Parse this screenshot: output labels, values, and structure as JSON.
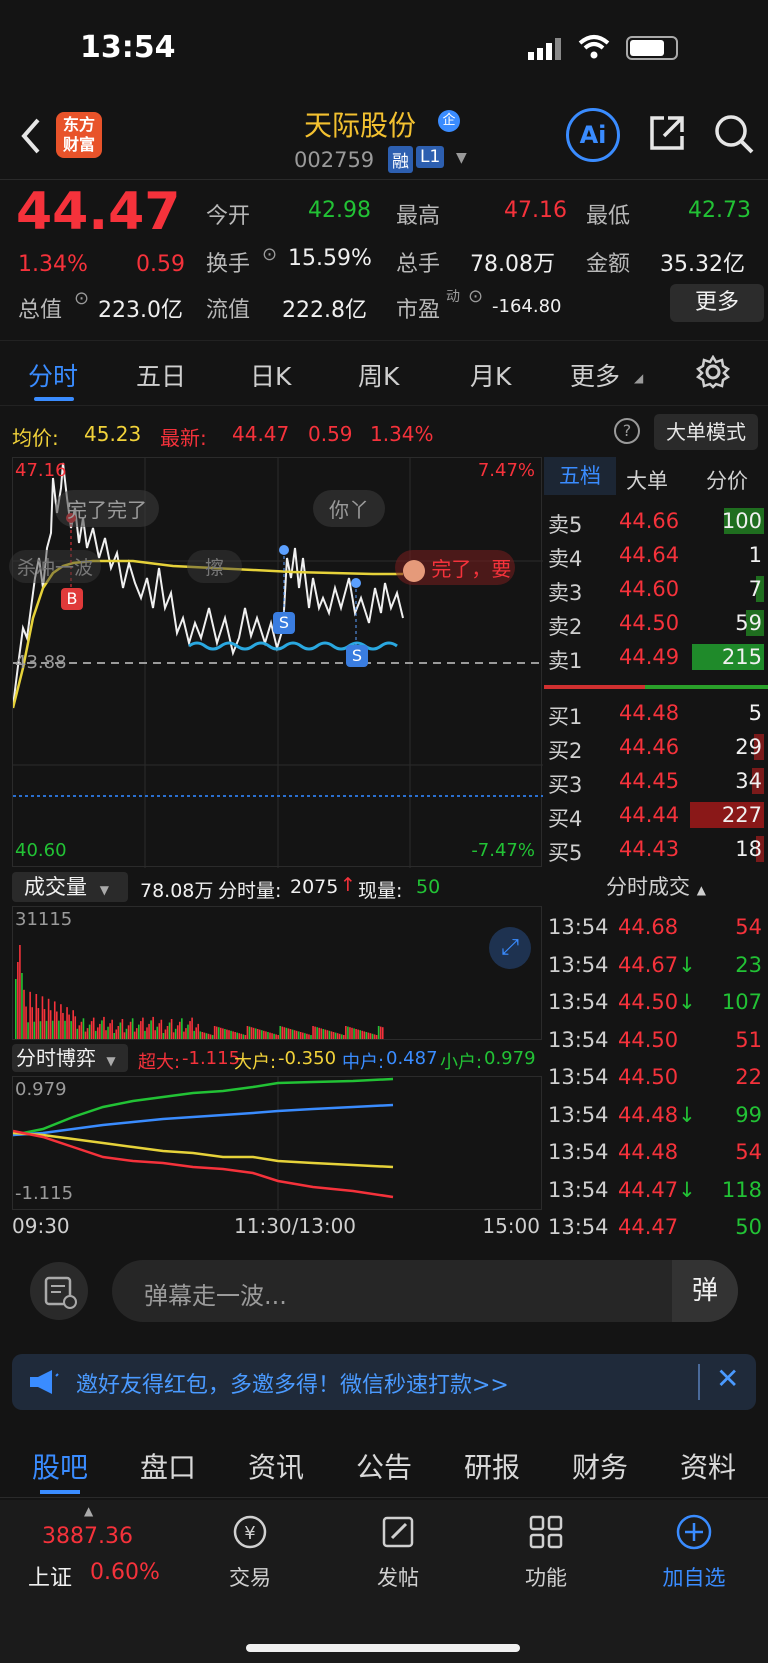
{
  "status": {
    "time": "13:54"
  },
  "header": {
    "stock_name": "天际股份",
    "name_badge": "企",
    "code": "002759",
    "tag_rong": "融",
    "tag_level": "L1",
    "logo_line1": "东方",
    "logo_line2": "财富",
    "ai_label": "Ai"
  },
  "quote": {
    "price": "44.47",
    "pct": "1.34%",
    "chg": "0.59",
    "open_label": "今开",
    "open": "42.98",
    "high_label": "最高",
    "high": "47.16",
    "low_label": "最低",
    "low": "42.73",
    "turnover_label": "换手",
    "turnover": "15.59%",
    "volume_label": "总手",
    "volume": "78.08万",
    "amount_label": "金额",
    "amount": "35.32亿",
    "mktcap_label": "总值",
    "mktcap": "223.0亿",
    "float_label": "流值",
    "float": "222.8亿",
    "pe_label": "市盈",
    "pe_sup": "动",
    "pe": "-164.80",
    "more_btn": "更多"
  },
  "tabs": [
    "分时",
    "五日",
    "日K",
    "周K",
    "月K",
    "更多"
  ],
  "chart_info": {
    "avg_label": "均价:",
    "avg": "45.23",
    "last_label": "最新:",
    "last": "44.47",
    "chg": "0.59",
    "pct": "1.34%",
    "big_order_btn": "大单模式"
  },
  "chart_labels": {
    "top_price": "47.16",
    "top_pct": "7.47%",
    "ref_price": "43.88",
    "bottom_price": "40.60",
    "bottom_pct": "-7.47%"
  },
  "bullets": {
    "b1": "完了完了",
    "b2": "你丫",
    "b3": "杀冲一波",
    "b4": "擦",
    "b5": "完了，要"
  },
  "markers": {
    "buy": "B",
    "sell": "S"
  },
  "depth_tabs": [
    "五档",
    "大单",
    "分价"
  ],
  "asks": [
    {
      "label": "卖5",
      "price": "44.66",
      "vol": "100"
    },
    {
      "label": "卖4",
      "price": "44.64",
      "vol": "1"
    },
    {
      "label": "卖3",
      "price": "44.60",
      "vol": "7"
    },
    {
      "label": "卖2",
      "price": "44.50",
      "vol": "59"
    },
    {
      "label": "卖1",
      "price": "44.49",
      "vol": "215"
    }
  ],
  "bids": [
    {
      "label": "买1",
      "price": "44.48",
      "vol": "5"
    },
    {
      "label": "买2",
      "price": "44.46",
      "vol": "29"
    },
    {
      "label": "买3",
      "price": "44.45",
      "vol": "34"
    },
    {
      "label": "买4",
      "price": "44.44",
      "vol": "227"
    },
    {
      "label": "买5",
      "price": "44.43",
      "vol": "18"
    }
  ],
  "ticks_title": "分时成交",
  "ticks": [
    {
      "t": "13:54",
      "p": "44.68",
      "v": "54",
      "dir": "",
      "vc": "red"
    },
    {
      "t": "13:54",
      "p": "44.67",
      "v": "23",
      "dir": "↓",
      "vc": "green"
    },
    {
      "t": "13:54",
      "p": "44.50",
      "v": "107",
      "dir": "↓",
      "vc": "green"
    },
    {
      "t": "13:54",
      "p": "44.50",
      "v": "51",
      "dir": "",
      "vc": "red"
    },
    {
      "t": "13:54",
      "p": "44.50",
      "v": "22",
      "dir": "",
      "vc": "red"
    },
    {
      "t": "13:54",
      "p": "44.48",
      "v": "99",
      "dir": "↓",
      "vc": "green"
    },
    {
      "t": "13:54",
      "p": "44.48",
      "v": "54",
      "dir": "",
      "vc": "red"
    },
    {
      "t": "13:54",
      "p": "44.47",
      "v": "118",
      "dir": "↓",
      "vc": "green"
    },
    {
      "t": "13:54",
      "p": "44.47",
      "v": "50",
      "dir": "",
      "vc": "green"
    }
  ],
  "volume": {
    "label": "成交量",
    "total": "78.08万",
    "tick_label": "分时量:",
    "tick": "2075",
    "cur_label": "现量:",
    "cur": "50",
    "max": "31115"
  },
  "game": {
    "label": "分时博弈",
    "super_label": "超大:",
    "super": "-1.115",
    "big_label": "大户:",
    "big": "-0.350",
    "mid_label": "中户:",
    "mid": "0.487",
    "small_label": "小户:",
    "small": "0.979",
    "ymax": "0.979",
    "ymin": "-1.115"
  },
  "time_axis": {
    "start": "09:30",
    "mid": "11:30/13:00",
    "end": "15:00"
  },
  "comment": {
    "placeholder": "弹幕走一波...",
    "send": "弹"
  },
  "banner": {
    "text": "邀好友得红包，多邀多得！微信秒速打款>>"
  },
  "bottom_tabs": [
    "股吧",
    "盘口",
    "资讯",
    "公告",
    "研报",
    "财务",
    "资料"
  ],
  "tabbar": {
    "index_value": "3887.36",
    "index_name": "上证",
    "index_pct": "0.60%",
    "trade": "交易",
    "post": "发帖",
    "func": "功能",
    "add": "加自选"
  },
  "colors": {
    "up": "#f5323b",
    "down": "#22c235",
    "accent": "#3a8cff",
    "avg_line": "#e6d23a"
  }
}
